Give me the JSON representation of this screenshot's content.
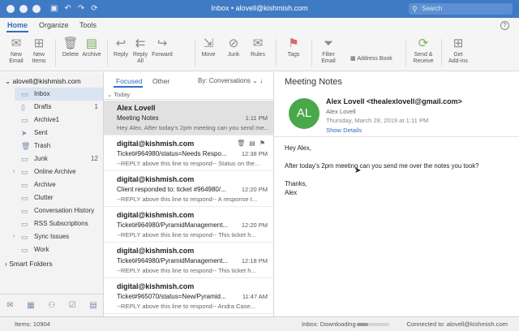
{
  "window": {
    "title": "Inbox • alovell@kishmish.com",
    "search_placeholder": "Search"
  },
  "ribbon": {
    "tabs": [
      "Home",
      "Organize",
      "Tools"
    ],
    "buttons": {
      "new_email": [
        "New",
        "Email"
      ],
      "new_items": [
        "New",
        "Items"
      ],
      "delete": "Delete",
      "archive": "Archive",
      "reply": "Reply",
      "reply_all": [
        "Reply",
        "All"
      ],
      "forward": "Forward",
      "move": "Move",
      "junk": "Junk",
      "rules": "Rules",
      "tags": "Tags",
      "filter_email": [
        "Filter",
        "Email"
      ],
      "address_book": "Address Book",
      "send_receive": [
        "Send &",
        "Receive"
      ],
      "get_addins": [
        "Get",
        "Add-ins"
      ]
    }
  },
  "sidebar": {
    "account": "alovell@kishmish.com",
    "folders": [
      {
        "label": "Inbox",
        "count": ""
      },
      {
        "label": "Drafts",
        "count": "1"
      },
      {
        "label": "Archive1",
        "count": ""
      },
      {
        "label": "Sent",
        "count": ""
      },
      {
        "label": "Trash",
        "count": ""
      },
      {
        "label": "Junk",
        "count": "12"
      },
      {
        "label": "Online Archive",
        "count": ""
      },
      {
        "label": "Archive",
        "count": ""
      },
      {
        "label": "Clutter",
        "count": ""
      },
      {
        "label": "Conversation History",
        "count": ""
      },
      {
        "label": "RSS Subscriptions",
        "count": ""
      },
      {
        "label": "Sync Issues",
        "count": ""
      },
      {
        "label": "Work",
        "count": ""
      }
    ],
    "smart_folders": "Smart Folders"
  },
  "message_list": {
    "tabs": [
      "Focused",
      "Other"
    ],
    "sort": "By: Conversations",
    "group": "Today",
    "messages": [
      {
        "from": "Alex Lovell",
        "subject": "Meeting Notes",
        "time": "1:11 PM",
        "preview": "Hey Alex, After today's 2pm meeting can you send me..."
      },
      {
        "from": "digital@kishmish.com",
        "subject": "Ticket#964980/status=Needs Respo...",
        "time": "12:38 PM",
        "preview": "--REPLY above this line to respond-- Status on the..."
      },
      {
        "from": "digital@kishmish.com",
        "subject": "Client responded to: ticket #964980/...",
        "time": "12:20 PM",
        "preview": "--REPLY above this line to respond-- A response t..."
      },
      {
        "from": "digital@kishmish.com",
        "subject": "Ticket#964980/PyramidManagement...",
        "time": "12:20 PM",
        "preview": "--REPLY above this line to respond-- This ticket h..."
      },
      {
        "from": "digital@kishmish.com",
        "subject": "Ticket#964980/PyramidManagement...",
        "time": "12:18 PM",
        "preview": "--REPLY above this line to respond-- This ticket h..."
      },
      {
        "from": "digital@kishmish.com",
        "subject": "Ticket#965070/status=New/Pyramid...",
        "time": "11:47 AM",
        "preview": "--REPLY above this line to respond-- Andra Case..."
      }
    ]
  },
  "reader": {
    "subject": "Meeting Notes",
    "avatar_initials": "AL",
    "avatar_color": "#49a84a",
    "sender": "Alex Lovell <thealexlovell@gmail.com>",
    "to": "Alex Lovell",
    "date": "Thursday, March 28, 2019 at 1:11 PM",
    "show_details": "Show Details",
    "body": {
      "greeting": "Hey Alex,",
      "line1": "After today's 2pm meeting can you send me over the notes you took?",
      "signoff": "Thanks,",
      "name": "Alex"
    }
  },
  "status": {
    "items": "Items: 10904",
    "downloading": "Inbox: Downloading",
    "connected": "Connected to: alovell@kishmish.com",
    "progress": 0.35
  }
}
